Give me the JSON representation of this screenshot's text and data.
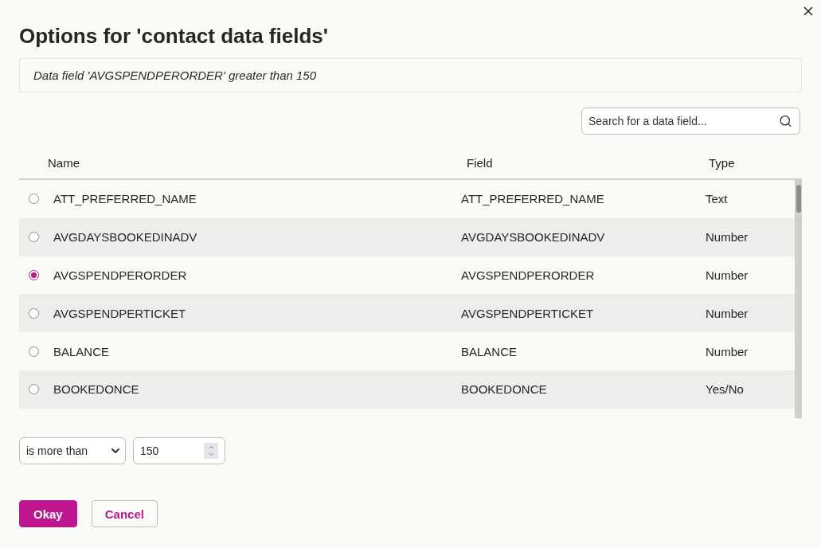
{
  "dialog": {
    "title": "Options for 'contact data fields'",
    "summary": "Data field 'AVGSPENDPERORDER' greater than 150"
  },
  "search": {
    "placeholder": "Search for a data field..."
  },
  "table": {
    "columns": [
      "Name",
      "Field",
      "Type"
    ],
    "rows": [
      {
        "name": "ATT_PREFERRED_NAME",
        "field": "ATT_PREFERRED_NAME",
        "type": "Text",
        "selected": false
      },
      {
        "name": "AVGDAYSBOOKEDINADV",
        "field": "AVGDAYSBOOKEDINADV",
        "type": "Number",
        "selected": false
      },
      {
        "name": "AVGSPENDPERORDER",
        "field": "AVGSPENDPERORDER",
        "type": "Number",
        "selected": true
      },
      {
        "name": "AVGSPENDPERTICKET",
        "field": "AVGSPENDPERTICKET",
        "type": "Number",
        "selected": false
      },
      {
        "name": "BALANCE",
        "field": "BALANCE",
        "type": "Number",
        "selected": false
      },
      {
        "name": "BOOKEDONCE",
        "field": "BOOKEDONCE",
        "type": "Yes/No",
        "selected": false
      }
    ]
  },
  "condition": {
    "operator": "is more than",
    "value": "150"
  },
  "buttons": [
    {
      "label": "Okay",
      "kind": "primary"
    },
    {
      "label": "Cancel",
      "kind": "secondary"
    }
  ]
}
